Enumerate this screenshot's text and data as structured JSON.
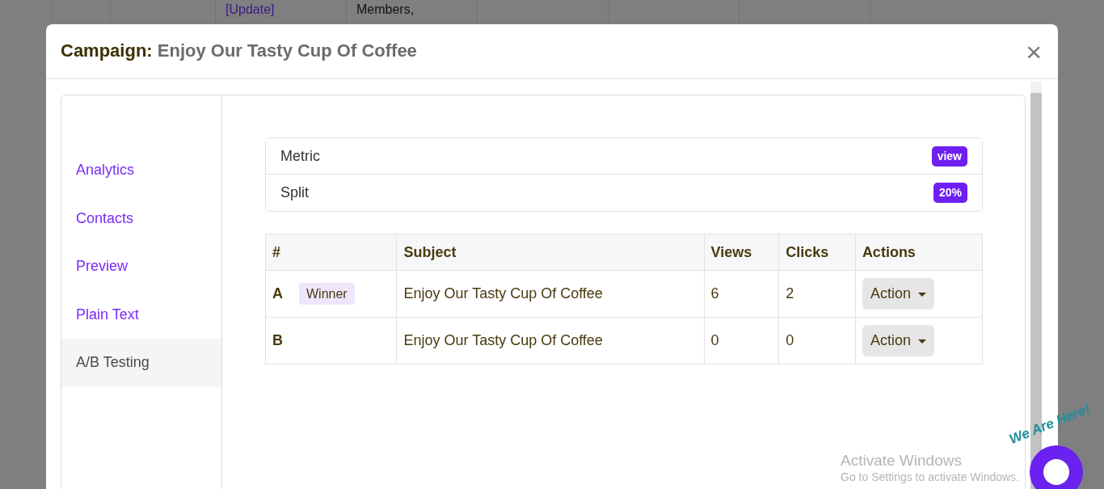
{
  "background_table": {
    "cells": [
      {},
      {},
      {
        "lines": [
          {
            "text": "[Update]",
            "kind": "link"
          }
        ]
      },
      {
        "lines": [
          {
            "text": "Members,",
            "kind": "text"
          }
        ]
      },
      {},
      {},
      {},
      {}
    ]
  },
  "modal": {
    "title_label": "Campaign:",
    "title_value": "Enjoy Our Tasty Cup Of Coffee",
    "close": "×"
  },
  "sidebar": {
    "items": [
      {
        "label": "Analytics",
        "selected": false
      },
      {
        "label": "Contacts",
        "selected": false
      },
      {
        "label": "Preview",
        "selected": false
      },
      {
        "label": "Plain Text",
        "selected": false
      },
      {
        "label": "A/B Testing",
        "selected": true
      }
    ]
  },
  "settings": [
    {
      "label": "Metric",
      "value": "view"
    },
    {
      "label": "Split",
      "value": "20%"
    }
  ],
  "table": {
    "columns": [
      "#",
      "Subject",
      "Views",
      "Clicks",
      "Actions"
    ],
    "rows": [
      {
        "variant": "A",
        "badge": "Winner",
        "subject": "Enjoy Our Tasty Cup Of Coffee",
        "views": "6",
        "clicks": "2",
        "action": "Action"
      },
      {
        "variant": "B",
        "subject": "Enjoy Our Tasty Cup Of Coffee",
        "views": "0",
        "clicks": "0",
        "action": "Action"
      }
    ]
  },
  "os_notice": {
    "title": "Activate Windows",
    "subtitle": "Go to Settings to activate Windows."
  },
  "chat_widget": {
    "label": "We Are Here!"
  }
}
